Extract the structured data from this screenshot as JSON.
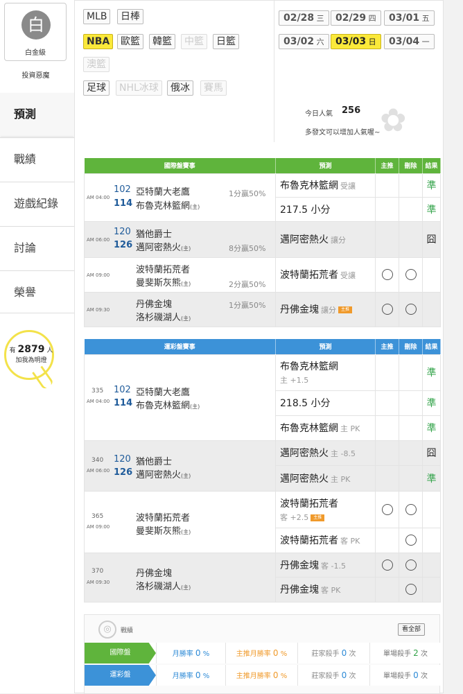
{
  "user": {
    "avatar_char": "白",
    "rank": "白金級",
    "name": "投資惡魔"
  },
  "nav": [
    "預測",
    "戰績",
    "遊戲紀錄",
    "討論",
    "榮譽"
  ],
  "fans": {
    "prefix": "有",
    "count": "2879",
    "suffix": "人",
    "text": "加我為明燈"
  },
  "sports": {
    "row1": [
      "MLB",
      "日棒"
    ],
    "row2": [
      "NBA",
      "歐籃",
      "韓籃",
      "中籃",
      "日籃"
    ],
    "row3": [
      "澳籃"
    ],
    "row4": [
      "足球",
      "NHL冰球",
      "俄冰",
      "賽馬"
    ]
  },
  "dates": [
    {
      "md": "02/28",
      "day": "三"
    },
    {
      "md": "02/29",
      "day": "四"
    },
    {
      "md": "03/01",
      "day": "五"
    },
    {
      "md": "03/02",
      "day": "六"
    },
    {
      "md": "03/03",
      "day": "日"
    },
    {
      "md": "03/04",
      "day": "一"
    }
  ],
  "popularity": {
    "label": "今日人氣",
    "count": "256",
    "note": "多發文可以增加人氣喔~"
  },
  "intl": {
    "headers": [
      "國際盤賽事",
      "預測",
      "主推",
      "刪除",
      "結果"
    ],
    "games": [
      {
        "time": "AM 04:00",
        "away_num": "102",
        "away": "亞特蘭大老鷹",
        "home_num": "114",
        "home": "布魯克林籃網",
        "line": "1分贏50%",
        "picks": [
          {
            "team": "布魯克林籃網",
            "sub": "受讓",
            "result": "準"
          },
          {
            "team": "217.5 小分",
            "sub": "",
            "result": "準"
          }
        ]
      },
      {
        "time": "AM 06:00",
        "away_num": "120",
        "away": "猶他爵士",
        "home_num": "126",
        "home": "邁阿密熱火",
        "line": "8分贏50%",
        "picks": [
          {
            "team": "邁阿密熱火",
            "sub": "讓分",
            "result": "囧"
          }
        ]
      },
      {
        "time": "AM 09:00",
        "away": "波特蘭拓荒者",
        "home": "曼斐斯灰熊",
        "line": "2分贏50%",
        "picks": [
          {
            "team": "波特蘭拓荒者",
            "sub": "受讓"
          }
        ]
      },
      {
        "time": "AM 09:30",
        "away": "丹佛金塊",
        "home": "洛杉磯湖人",
        "line": "1分贏50%",
        "picks": [
          {
            "team": "丹佛金塊",
            "sub": "讓分",
            "badge": "主推"
          }
        ]
      }
    ]
  },
  "sport_lottery": {
    "headers": [
      "運彩盤賽事",
      "預測",
      "主推",
      "刪除",
      "結果"
    ],
    "games": [
      {
        "no": "335",
        "time": "AM 04:00",
        "away_num": "102",
        "away": "亞特蘭大老鷹",
        "home_num": "114",
        "home": "布魯克林籃網",
        "picks": [
          {
            "team": "布魯克林籃網",
            "sub": "主 +1.5",
            "result": "準"
          },
          {
            "team": "218.5 小分",
            "result": "準"
          },
          {
            "team": "布魯克林籃網",
            "sub": "主 PK",
            "result": "準"
          }
        ]
      },
      {
        "no": "340",
        "time": "AM 06:00",
        "away_num": "120",
        "away": "猶他爵士",
        "home_num": "126",
        "home": "邁阿密熱火",
        "picks": [
          {
            "team": "邁阿密熱火",
            "sub": "主 -8.5",
            "result": "囧"
          },
          {
            "team": "邁阿密熱火",
            "sub": "主 PK",
            "result": "準"
          }
        ]
      },
      {
        "no": "365",
        "time": "AM 09:00",
        "away": "波特蘭拓荒者",
        "home": "曼斐斯灰熊",
        "picks": [
          {
            "team": "波特蘭拓荒者",
            "sub": "客 +2.5",
            "badge": "主推"
          },
          {
            "team": "波特蘭拓荒者",
            "sub": "客 PK"
          }
        ]
      },
      {
        "no": "370",
        "time": "AM 09:30",
        "away": "丹佛金塊",
        "home": "洛杉磯湖人",
        "picks": [
          {
            "team": "丹佛金塊",
            "sub": "客 -1.5"
          },
          {
            "team": "丹佛金塊",
            "sub": "客 PK"
          }
        ]
      }
    ]
  },
  "home_mark": "(主)",
  "stats": {
    "title": "戰績",
    "see_all": "看全部",
    "rows": [
      {
        "label": "國際盤",
        "c1": "月勝率",
        "v1": "0",
        "u1": "%",
        "c2": "主推月勝率",
        "v2": "0",
        "u2": "%",
        "c3": "莊家殺手",
        "v3": "0",
        "u3": "次",
        "c4": "單場殺手",
        "v4": "2",
        "u4": "次"
      },
      {
        "label": "運彩盤",
        "c1": "月勝率",
        "v1": "0",
        "u1": "%",
        "c2": "主推月勝率",
        "v2": "0",
        "u2": "%",
        "c3": "莊家殺手",
        "v3": "0",
        "u3": "次",
        "c4": "單場殺手",
        "v4": "0",
        "u4": "次"
      }
    ]
  },
  "colors": {
    "green": "#5fb43c",
    "blue": "#3c92d8",
    "yellow": "#fbe93a",
    "win": "#33a34a"
  }
}
